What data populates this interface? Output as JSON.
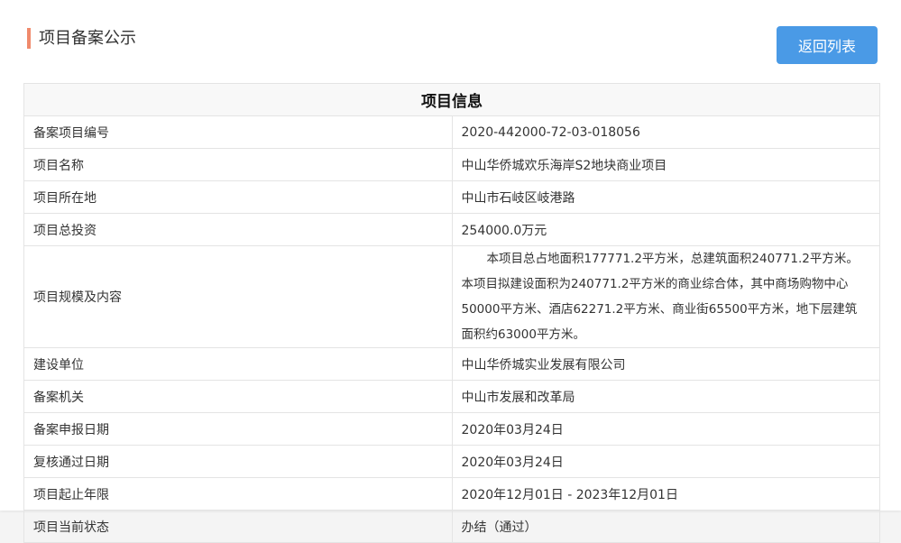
{
  "header": {
    "title": "项目备案公示",
    "back_label": "返回列表"
  },
  "table": {
    "caption": "项目信息",
    "rows": [
      {
        "label": "备案项目编号",
        "value": "2020-442000-72-03-018056"
      },
      {
        "label": "项目名称",
        "value": "中山华侨城欢乐海岸S2地块商业项目"
      },
      {
        "label": "项目所在地",
        "value": "中山市石岐区岐港路"
      },
      {
        "label": "项目总投资",
        "value": "254000.0万元"
      },
      {
        "label": "项目规模及内容",
        "value": "本项目总占地面积177771.2平方米，总建筑面积240771.2平方米。本项目拟建设面积为240771.2平方米的商业综合体，其中商场购物中心50000平方米、酒店62271.2平方米、商业街65500平方米，地下层建筑面积约63000平方米。"
      },
      {
        "label": "建设单位",
        "value": "中山华侨城实业发展有限公司"
      },
      {
        "label": "备案机关",
        "value": "中山市发展和改革局"
      },
      {
        "label": "备案申报日期",
        "value": "2020年03月24日"
      },
      {
        "label": "复核通过日期",
        "value": "2020年03月24日"
      },
      {
        "label": "项目起止年限",
        "value": "2020年12月01日 - 2023年12月01日"
      },
      {
        "label": "项目当前状态",
        "value": "办结（通过）"
      }
    ]
  },
  "colors": {
    "accent_bar": "#f08a6c",
    "button": "#4a9ae6",
    "border": "#e4e4e4"
  }
}
